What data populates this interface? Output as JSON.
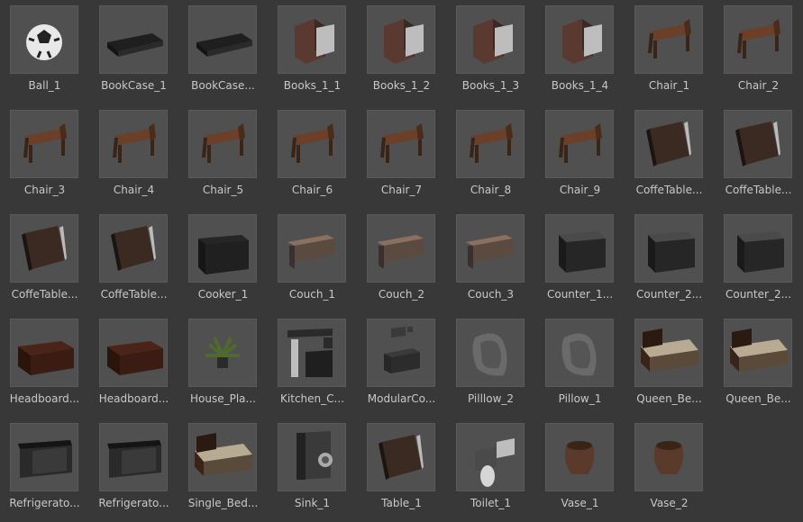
{
  "assets": [
    {
      "name": "Ball_1",
      "icon": "ball-icon"
    },
    {
      "name": "BookCase_1",
      "icon": "bookcase-icon"
    },
    {
      "name": "BookCase...",
      "icon": "bookcase-icon"
    },
    {
      "name": "Books_1_1",
      "icon": "books-icon"
    },
    {
      "name": "Books_1_2",
      "icon": "books-icon"
    },
    {
      "name": "Books_1_3",
      "icon": "books-icon"
    },
    {
      "name": "Books_1_4",
      "icon": "books-icon"
    },
    {
      "name": "Chair_1",
      "icon": "chair-icon"
    },
    {
      "name": "Chair_2",
      "icon": "chair-icon"
    },
    {
      "name": "Chair_3",
      "icon": "chair-icon"
    },
    {
      "name": "Chair_4",
      "icon": "chair-icon"
    },
    {
      "name": "Chair_5",
      "icon": "chair-icon"
    },
    {
      "name": "Chair_6",
      "icon": "chair-icon"
    },
    {
      "name": "Chair_7",
      "icon": "chair-icon"
    },
    {
      "name": "Chair_8",
      "icon": "chair-icon"
    },
    {
      "name": "Chair_9",
      "icon": "chair-icon"
    },
    {
      "name": "CoffeTable...",
      "icon": "table-icon"
    },
    {
      "name": "CoffeTable...",
      "icon": "table-icon"
    },
    {
      "name": "CoffeTable...",
      "icon": "table-icon"
    },
    {
      "name": "CoffeTable...",
      "icon": "table-icon"
    },
    {
      "name": "Cooker_1",
      "icon": "cooker-icon"
    },
    {
      "name": "Couch_1",
      "icon": "couch-icon"
    },
    {
      "name": "Couch_2",
      "icon": "couch-icon"
    },
    {
      "name": "Couch_3",
      "icon": "couch-icon"
    },
    {
      "name": "Counter_1...",
      "icon": "counter-icon"
    },
    {
      "name": "Counter_2...",
      "icon": "counter-icon"
    },
    {
      "name": "Counter_2...",
      "icon": "counter-icon"
    },
    {
      "name": "Headboard...",
      "icon": "headboard-icon"
    },
    {
      "name": "Headboard...",
      "icon": "headboard-icon"
    },
    {
      "name": "House_Pla...",
      "icon": "plant-icon"
    },
    {
      "name": "Kitchen_C...",
      "icon": "kitchen-cabinet-icon"
    },
    {
      "name": "ModularCo...",
      "icon": "modular-couch-icon"
    },
    {
      "name": "Pilllow_2",
      "icon": "pillow-icon"
    },
    {
      "name": "Pillow_1",
      "icon": "pillow-icon"
    },
    {
      "name": "Queen_Be...",
      "icon": "bed-icon"
    },
    {
      "name": "Queen_Be...",
      "icon": "bed-icon"
    },
    {
      "name": "Refrigerato...",
      "icon": "refrigerator-icon"
    },
    {
      "name": "Refrigerato...",
      "icon": "refrigerator-icon"
    },
    {
      "name": "Single_Bed...",
      "icon": "bed-icon"
    },
    {
      "name": "Sink_1",
      "icon": "sink-icon"
    },
    {
      "name": "Table_1",
      "icon": "table-icon"
    },
    {
      "name": "Toilet_1",
      "icon": "toilet-icon"
    },
    {
      "name": "Vase_1",
      "icon": "vase-icon"
    },
    {
      "name": "Vase_2",
      "icon": "vase-icon"
    }
  ],
  "colors": {
    "background": "#383838",
    "thumb_background": "#505050",
    "label": "#c8c8c8"
  }
}
